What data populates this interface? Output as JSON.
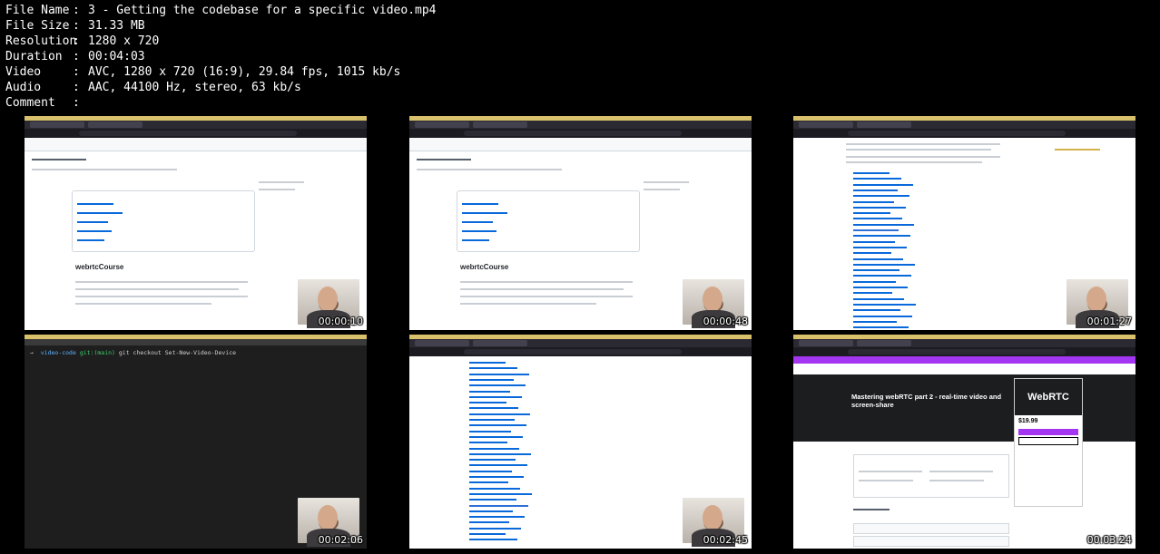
{
  "file_info": [
    {
      "key": "File Name",
      "sep": ":",
      "value": "3 - Getting the codebase for a specific video.mp4"
    },
    {
      "key": "File Size",
      "sep": ":",
      "value": "31.33 MB"
    },
    {
      "key": "Resolution",
      "sep": ":",
      "value": "1280 x 720"
    },
    {
      "key": "Duration",
      "sep": ":",
      "value": "00:04:03"
    },
    {
      "key": "Video",
      "sep": ":",
      "value": "AVC, 1280 x 720 (16:9), 29.84 fps, 1015 kb/s"
    },
    {
      "key": "Audio",
      "sep": ":",
      "value": "AAC, 44100 Hz, stereo, 63 kb/s"
    },
    {
      "key": "Comment",
      "sep": ":",
      "value": ""
    }
  ],
  "thumbnails": [
    {
      "timestamp": "00:00:10",
      "scene": "github-repo",
      "heading": "webrtcCourse"
    },
    {
      "timestamp": "00:00:48",
      "scene": "github-repo",
      "heading": "webrtcCourse"
    },
    {
      "timestamp": "00:01:27",
      "scene": "github-list"
    },
    {
      "timestamp": "00:02:06",
      "scene": "terminal",
      "prompt_dir": "video-code",
      "branch": "git:(main)",
      "command": "git checkout Set-New-Video-Device"
    },
    {
      "timestamp": "00:02:45",
      "scene": "github-list"
    },
    {
      "timestamp": "00:03:24",
      "scene": "udemy",
      "course_title": "Mastering webRTC part 2 - real-time video and screen-share",
      "price": "$19.99",
      "preview_text": "WebRTC"
    }
  ]
}
